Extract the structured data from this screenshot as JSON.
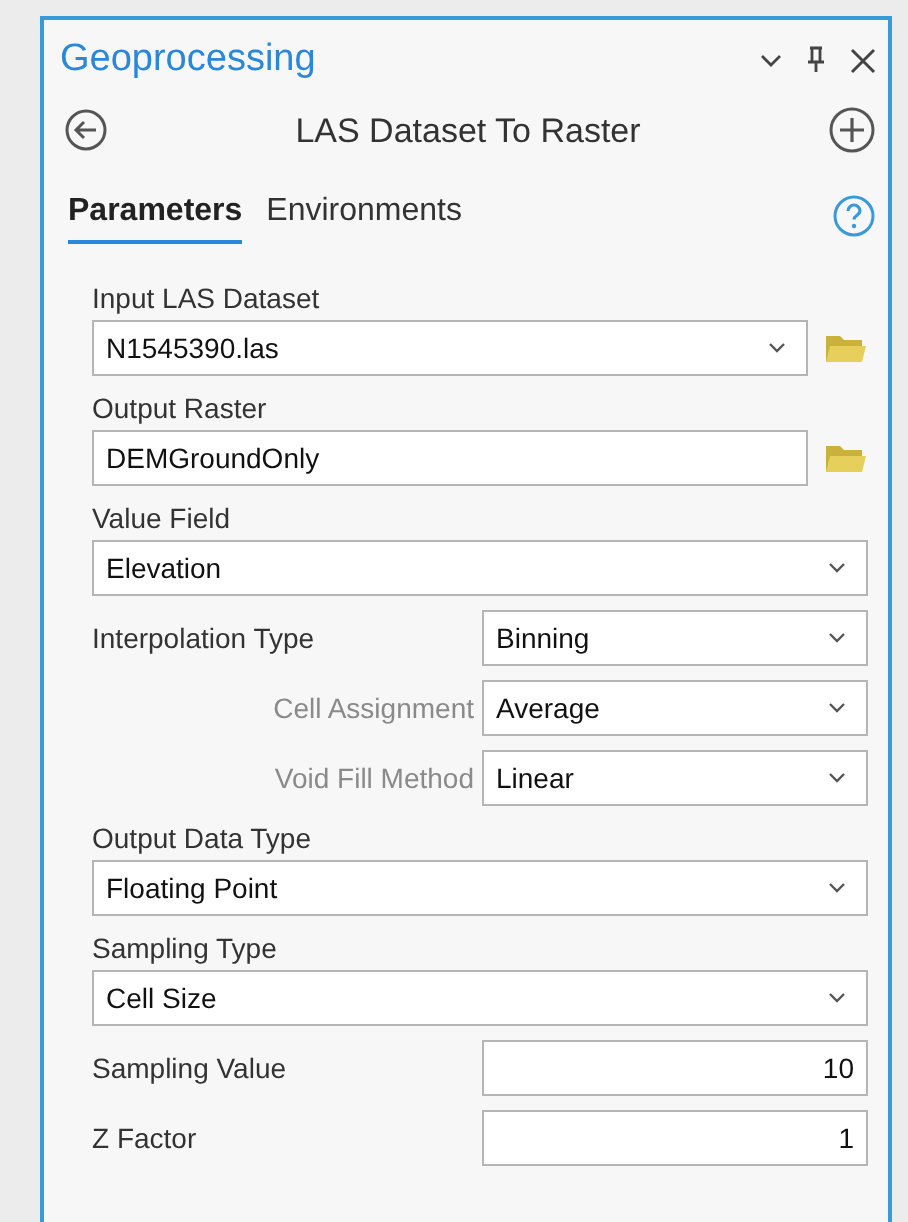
{
  "pane": {
    "title": "Geoprocessing",
    "tool_title": "LAS Dataset To Raster"
  },
  "tabs": [
    {
      "label": "Parameters",
      "selected": true
    },
    {
      "label": "Environments",
      "selected": false
    }
  ],
  "parameters": [
    {
      "kind": "stacked",
      "label": "Input LAS Dataset",
      "field": {
        "kind": "dropdown",
        "value": "N1545390.las"
      },
      "browse": true
    },
    {
      "kind": "stacked",
      "label": "Output Raster",
      "field": {
        "kind": "text",
        "value": "DEMGroundOnly"
      },
      "browse": true
    },
    {
      "kind": "stacked",
      "label": "Value Field",
      "field": {
        "kind": "dropdown",
        "value": "Elevation"
      },
      "browse": false
    },
    {
      "kind": "inline",
      "label": "Interpolation Type",
      "field": {
        "kind": "dropdown",
        "value": "Binning"
      },
      "dependent": false
    },
    {
      "kind": "inline",
      "label": "Cell Assignment",
      "field": {
        "kind": "dropdown",
        "value": "Average"
      },
      "dependent": true
    },
    {
      "kind": "inline",
      "label": "Void Fill Method",
      "field": {
        "kind": "dropdown",
        "value": "Linear"
      },
      "dependent": true
    },
    {
      "kind": "stacked",
      "label": "Output Data Type",
      "field": {
        "kind": "dropdown",
        "value": "Floating Point"
      },
      "browse": false
    },
    {
      "kind": "stacked",
      "label": "Sampling Type",
      "field": {
        "kind": "dropdown",
        "value": "Cell Size"
      },
      "browse": false
    },
    {
      "kind": "inline",
      "label": "Sampling Value",
      "field": {
        "kind": "number",
        "value": "10"
      },
      "dependent": false
    },
    {
      "kind": "inline",
      "label": "Z Factor",
      "field": {
        "kind": "number",
        "value": "1"
      },
      "dependent": false
    }
  ]
}
